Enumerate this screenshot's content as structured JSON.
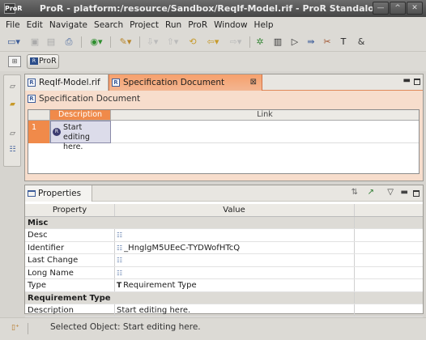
{
  "window": {
    "title": "ProR - platform:/resource/Sandbox/ReqIf-Model.rif - ProR Standalone",
    "app_icon": "ProR"
  },
  "window_controls": [
    "minimize-icon",
    "maximize-icon",
    "close-icon"
  ],
  "menu": [
    "File",
    "Edit",
    "Navigate",
    "Search",
    "Project",
    "Run",
    "ProR",
    "Window",
    "Help"
  ],
  "perspective": {
    "label": "ProR"
  },
  "editor": {
    "tabs": [
      {
        "label": "ReqIf-Model.rif",
        "active": false
      },
      {
        "label": "Specification Document",
        "active": true
      }
    ],
    "header": "Specification Document",
    "grid": {
      "columns": [
        "Description",
        "Link"
      ],
      "rows": [
        {
          "num": "1",
          "description": "Start editing here.",
          "link": ""
        }
      ]
    }
  },
  "properties": {
    "tab_label": "Properties",
    "columns": [
      "Property",
      "Value"
    ],
    "rows": [
      {
        "kind": "category",
        "property": "Misc",
        "value": ""
      },
      {
        "kind": "row",
        "property": "Desc",
        "value": "",
        "icon": "attribute-icon"
      },
      {
        "kind": "row",
        "property": "Identifier",
        "value": "_HnglgM5UEeC-TYDWofHTcQ",
        "icon": "attribute-icon"
      },
      {
        "kind": "row",
        "property": "Last Change",
        "value": "",
        "icon": "attribute-icon"
      },
      {
        "kind": "row",
        "property": "Long Name",
        "value": "",
        "icon": "attribute-icon"
      },
      {
        "kind": "row",
        "property": "Type",
        "value": "Requirement Type",
        "icon": "type-icon"
      },
      {
        "kind": "category",
        "property": "Requirement Type",
        "value": ""
      },
      {
        "kind": "row",
        "property": "Description",
        "value": "Start editing here."
      }
    ]
  },
  "status": {
    "text": "Selected Object: Start editing here."
  }
}
